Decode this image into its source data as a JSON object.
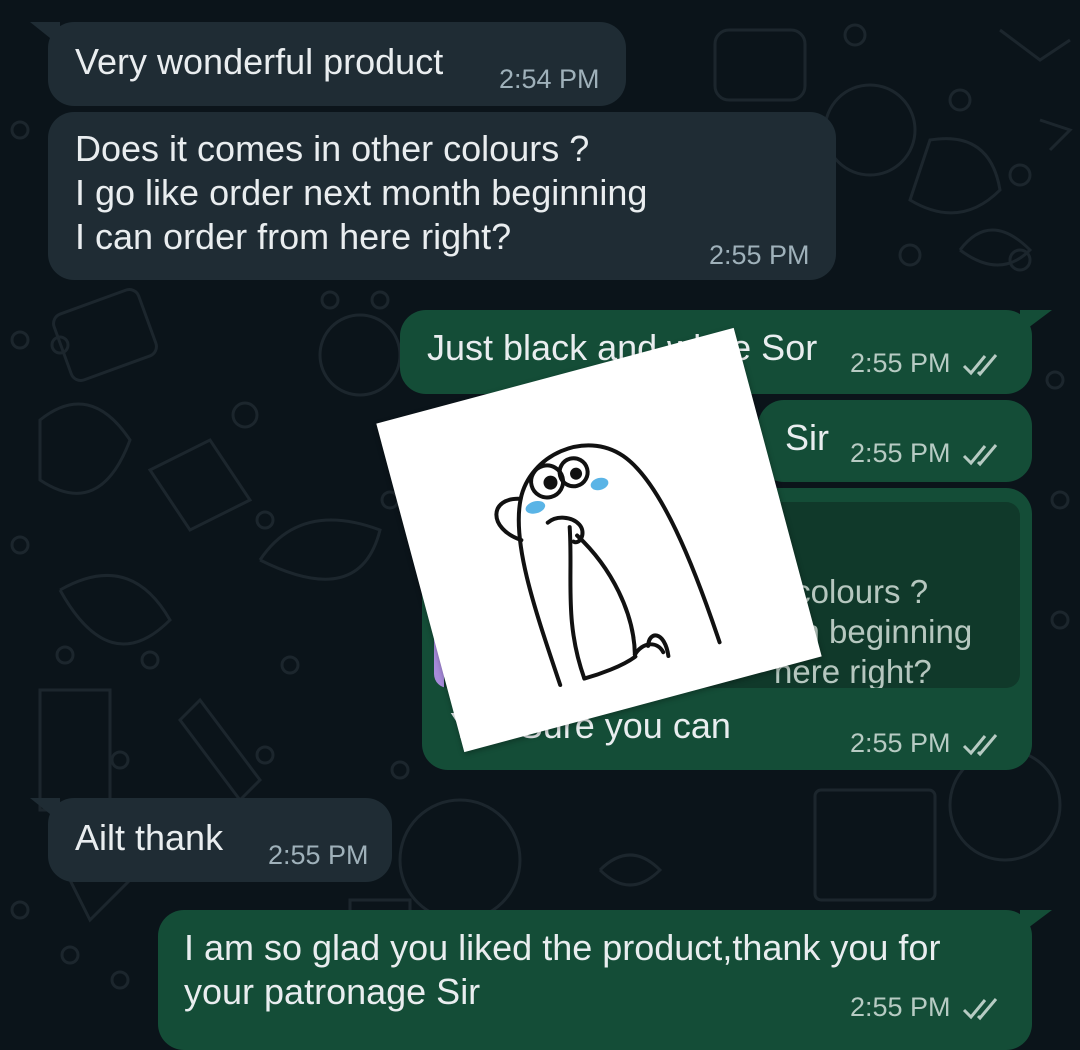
{
  "theme": {
    "background": "#0b141a",
    "incoming_bubble": "#1f2c34",
    "outgoing_bubble": "#144d37",
    "quote_bar": "#a78bdb",
    "tick_color": "#b7cbc3"
  },
  "messages": [
    {
      "text": "Very wonderful product",
      "time": "2:54 PM",
      "direction": "incoming"
    },
    {
      "text": "Does it comes in other colours ?\nI go like order next month beginning\nI can order from here right?",
      "time": "2:55 PM",
      "direction": "incoming"
    },
    {
      "text": "Just black and white Sor",
      "time": "2:55 PM",
      "direction": "outgoing",
      "status": "read-double-check"
    },
    {
      "text": "Sir",
      "time": "2:55 PM",
      "direction": "outgoing",
      "status": "read-double-check"
    },
    {
      "quoted": "r colours ?\nnth beginning\nhere right?",
      "text": "Yes Sure you can",
      "time": "2:55 PM",
      "direction": "outgoing",
      "status": "read-double-check"
    },
    {
      "text": "Ailt thank",
      "time": "2:55 PM",
      "direction": "incoming"
    },
    {
      "text": "I am so glad you liked the product,thank you for\nyour patronage Sir",
      "time": "2:55 PM",
      "direction": "outgoing",
      "status": "read-double-check"
    }
  ],
  "sticker": {
    "icon": "thinking-meme-sticker"
  }
}
